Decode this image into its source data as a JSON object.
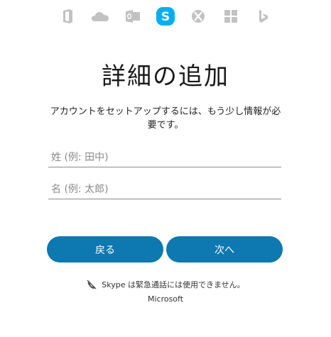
{
  "icons": [
    {
      "name": "office-icon",
      "color": "#c2c2c2"
    },
    {
      "name": "onedrive-icon",
      "color": "#c2c2c2"
    },
    {
      "name": "outlook-icon",
      "color": "#c2c2c2"
    },
    {
      "name": "skype-icon",
      "color": "#00aff0"
    },
    {
      "name": "xbox-icon",
      "color": "#c2c2c2"
    },
    {
      "name": "windows-icon",
      "color": "#c2c2c2"
    },
    {
      "name": "bing-icon",
      "color": "#c2c2c2"
    }
  ],
  "page": {
    "title": "詳細の追加",
    "description": "アカウントをセットアップするには、もう少し情報が必要です。"
  },
  "form": {
    "last_name_placeholder": "姓 (例: 田中)",
    "first_name_placeholder": "名 (例: 太郎)"
  },
  "buttons": {
    "back": "戻る",
    "next": "次へ",
    "accent_color": "#0e78b0"
  },
  "notice": {
    "text": "Skype は緊急通話には使用できません。",
    "icon": "no-emergency-call-icon"
  },
  "footer": {
    "brand": "Microsoft"
  }
}
